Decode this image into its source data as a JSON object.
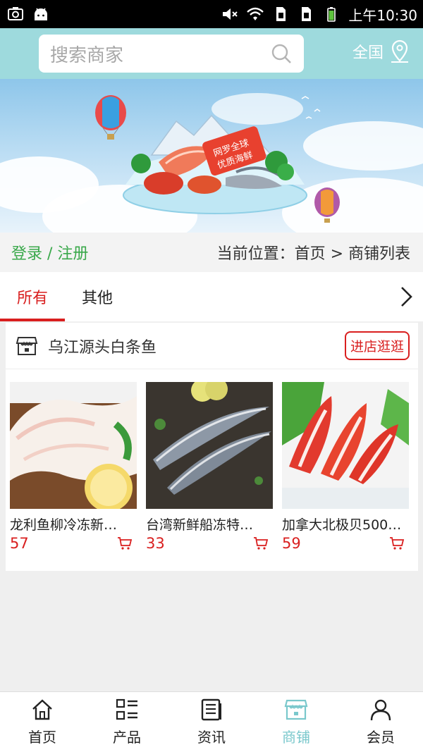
{
  "statusbar": {
    "time": "上午10:30"
  },
  "header": {
    "search_placeholder": "搜索商家",
    "region_label": "全国"
  },
  "banner": {
    "caption_line1": "网罗全球",
    "caption_line2": "优质海鲜"
  },
  "crumb": {
    "login": "登录 / 注册",
    "position": "当前位置：首页 > 商铺列表"
  },
  "tabs": [
    {
      "label": "所有"
    },
    {
      "label": "其他"
    }
  ],
  "shop": {
    "name": "乌江源头白条鱼",
    "visit_label": "进店逛逛",
    "products": [
      {
        "name": "龙利鱼柳冷冻新…",
        "price": "57"
      },
      {
        "name": "台湾新鲜船冻特…",
        "price": "33"
      },
      {
        "name": "加拿大北极贝500…",
        "price": "59"
      }
    ]
  },
  "nav": [
    {
      "label": "首页"
    },
    {
      "label": "产品"
    },
    {
      "label": "资讯"
    },
    {
      "label": "商铺"
    },
    {
      "label": "会员"
    }
  ],
  "colors": {
    "accent": "#d91f1f",
    "header_bg": "#9edadd",
    "login_green": "#39a84a",
    "nav_active": "#7ac8cc"
  }
}
